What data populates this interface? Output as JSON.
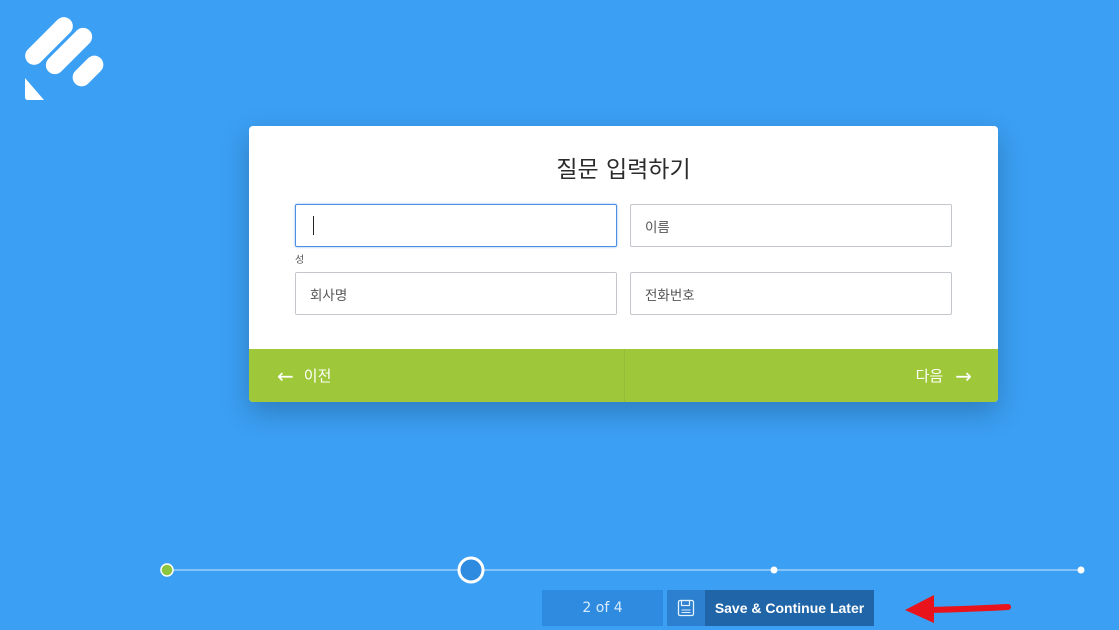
{
  "app": {
    "logo_icon": "jotform-logo-icon"
  },
  "form": {
    "title": "질문 입력하기",
    "fields": {
      "last_name": {
        "value": "",
        "placeholder": "",
        "sublabel": "성"
      },
      "first_name": {
        "value": "",
        "placeholder": "이름"
      },
      "company": {
        "value": "",
        "placeholder": "회사명"
      },
      "phone": {
        "value": "",
        "placeholder": "전화번호"
      }
    },
    "nav": {
      "prev_label": "이전",
      "prev_icon": "arrow-left-icon",
      "next_label": "다음",
      "next_icon": "arrow-right-icon"
    }
  },
  "progress": {
    "steps": 4,
    "current": 2,
    "completed": 1,
    "page_text": "2 of 4"
  },
  "save": {
    "label": "Save & Continue Later",
    "icon": "floppy-disk-icon"
  },
  "annotation": {
    "icon": "red-arrow-icon",
    "color": "#e8131b"
  },
  "colors": {
    "background": "#3b9ff3",
    "footer": "#9ec83a",
    "save_button": "#1f65a8",
    "step_done": "#8cc63f",
    "step_current": "#2f8be0"
  }
}
